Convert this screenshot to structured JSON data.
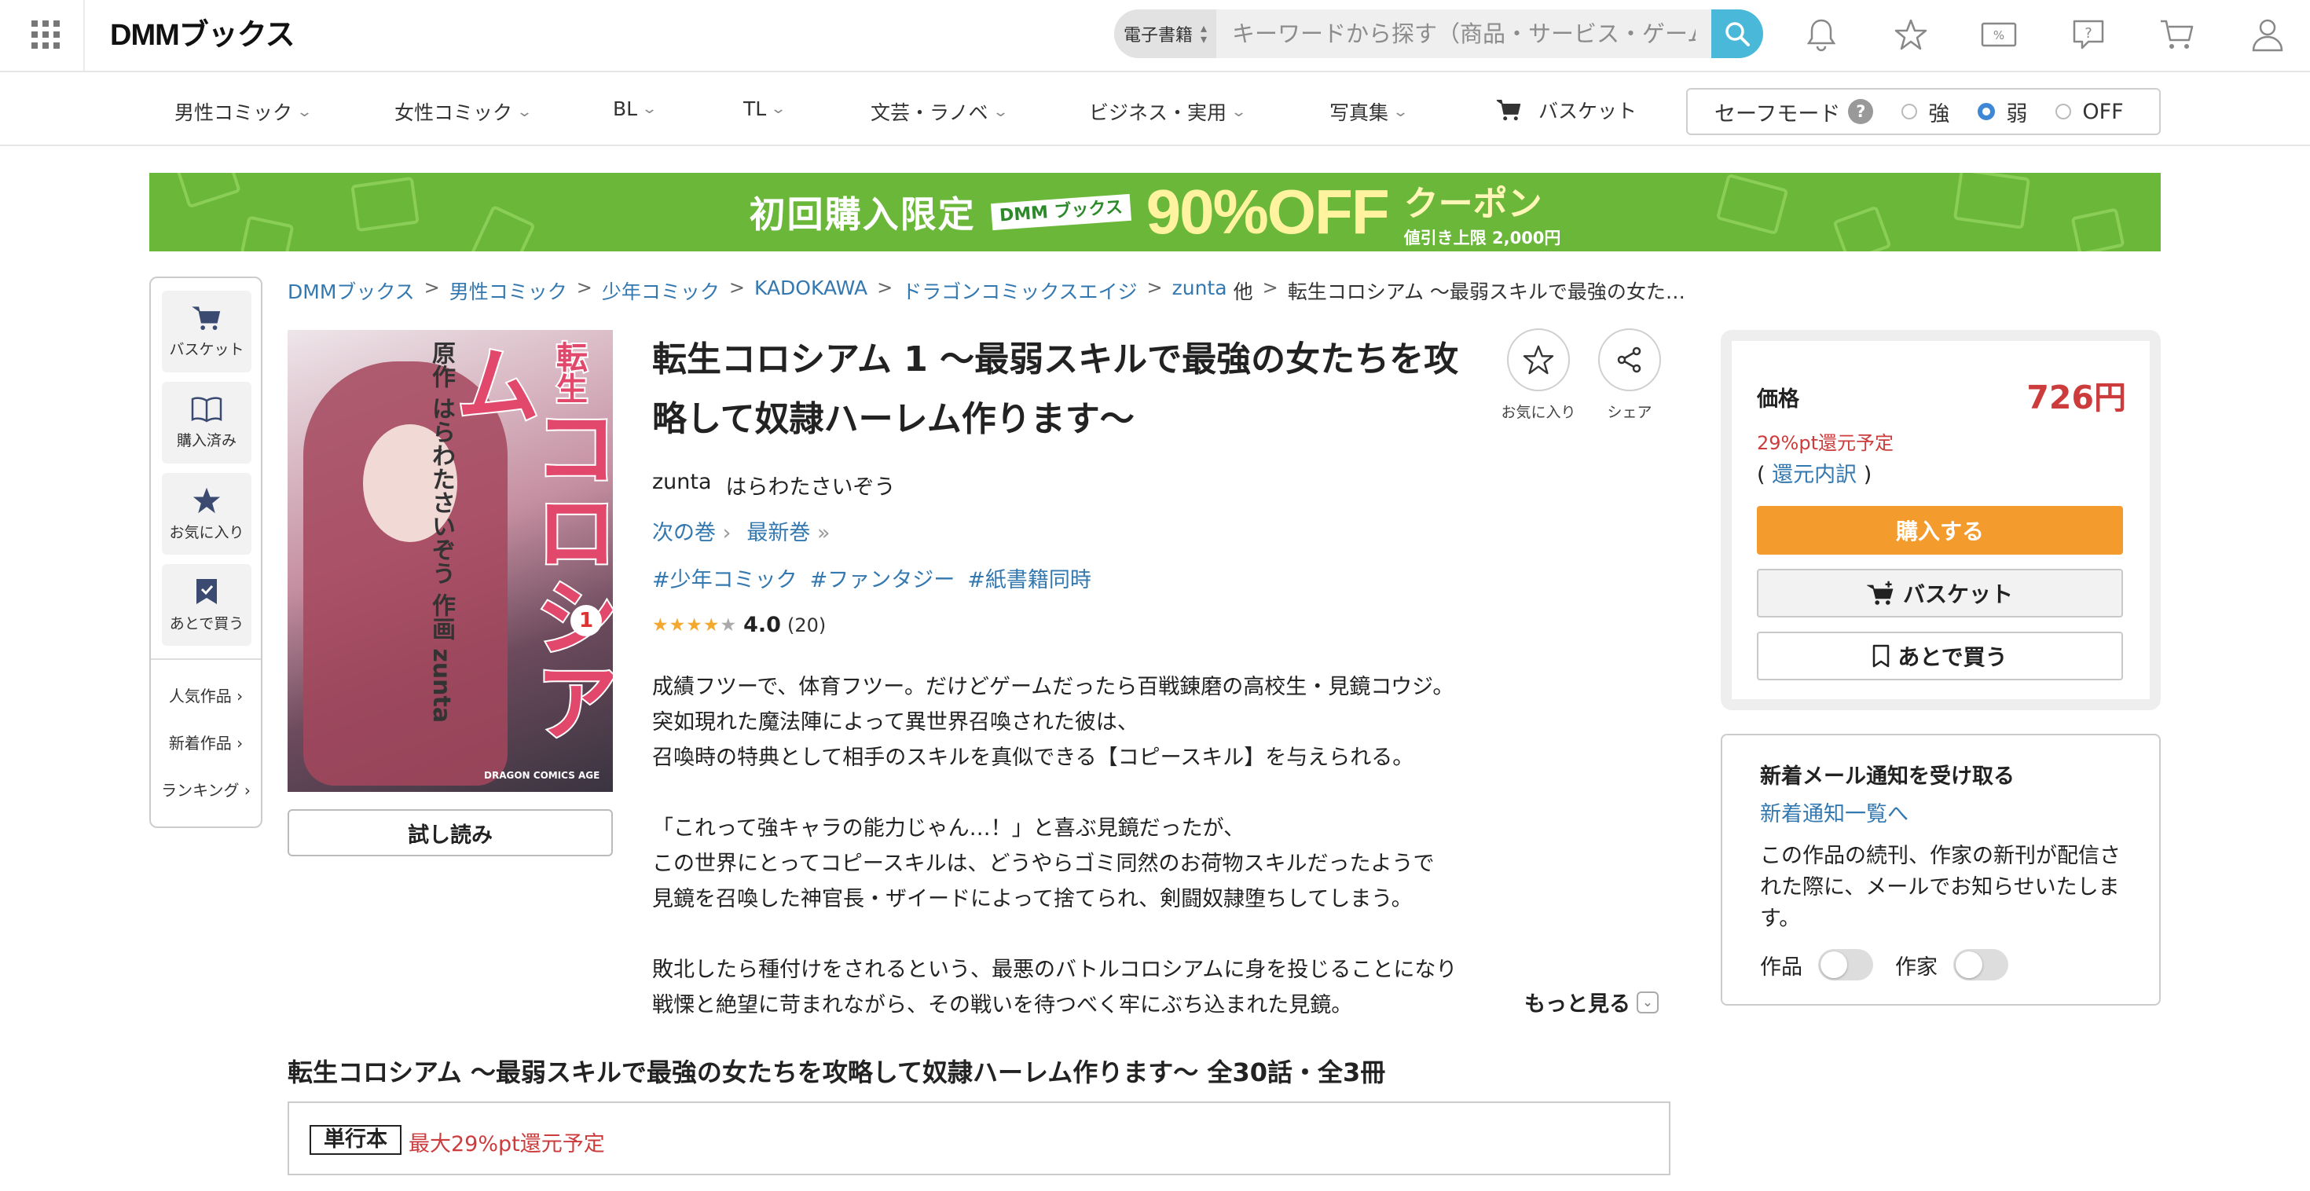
{
  "header": {
    "logo": "DMMブックス",
    "search_category": "電子書籍",
    "search_placeholder": "キーワードから探す（商品・サービス・ゲーム",
    "accent": "#4ab8d8"
  },
  "nav": {
    "items": [
      "男性コミック",
      "女性コミック",
      "BL",
      "TL",
      "文芸・ラノベ",
      "ビジネス・実用",
      "写真集"
    ],
    "basket": "バスケット",
    "safe_mode": {
      "label": "セーフモード",
      "help": "?",
      "options": [
        "強",
        "弱",
        "OFF"
      ],
      "selected": "弱"
    }
  },
  "banner": {
    "lead": "初回購入限定",
    "badge": "DMM ブックス",
    "discount": "90%OFF",
    "coupon": "クーポン",
    "cap": "値引き上限 2,000円",
    "color": "#6bb73a"
  },
  "sidebar": {
    "buttons": [
      {
        "label": "バスケット",
        "icon": "cart-icon"
      },
      {
        "label": "購入済み",
        "icon": "book-icon"
      },
      {
        "label": "お気に入り",
        "icon": "star-icon"
      },
      {
        "label": "あとで買う",
        "icon": "bookmark-icon"
      }
    ],
    "links": [
      "人気作品",
      "新着作品",
      "ランキング"
    ]
  },
  "breadcrumb": {
    "items": [
      "DMMブックス",
      "男性コミック",
      "少年コミック",
      "KADOKAWA",
      "ドラゴンコミックスエイジ",
      "zunta"
    ],
    "other": "他",
    "current": "転生コロシアム ～最弱スキルで最強の女た…"
  },
  "cover": {
    "title": "コロシアム",
    "prefix": "転生",
    "credits": "原作 はらわたさいぞう 作画 zunta",
    "volume": "1",
    "publisher": "DRAGON COMICS AGE"
  },
  "product": {
    "title": "転生コロシアム 1 ～最弱スキルで最強の女たちを攻略して奴隷ハーレム作ります～",
    "authors": [
      "zunta",
      "はらわたさいぞう"
    ],
    "next_volume": "次の巻",
    "latest_volume": "最新巻",
    "tags": [
      "#少年コミック",
      "#ファンタジー",
      "#紙書籍同時"
    ],
    "rating": 4.0,
    "rating_label": "4.0",
    "review_count": "(20)",
    "favorite_label": "お気に入り",
    "share_label": "シェア",
    "trial_label": "試し読み",
    "description": [
      "成績フツーで、体育フツー。だけどゲームだったら百戦錬磨の高校生・見鏡コウジ。",
      "突如現れた魔法陣によって異世界召喚された彼は、",
      "召喚時の特典として相手のスキルを真似できる【コピースキル】を与えられる。",
      "",
      "「これって強キャラの能力じゃん…！」と喜ぶ見鏡だったが、",
      "この世界にとってコピースキルは、どうやらゴミ同然のお荷物スキルだったようで",
      "見鏡を召喚した神官長・ザイードによって捨てられ、剣闘奴隷堕ちしてしまう。",
      "",
      "敗北したら種付けをされるという、最悪のバトルコロシアムに身を投じることになり",
      "戦慄と絶望に苛まれながら、その戦いを待つべく牢にぶち込まれた見鏡。"
    ],
    "more_label": "もっと見る"
  },
  "series": {
    "title": "転生コロシアム ～最弱スキルで最強の女たちを攻略して奴隷ハーレム作ります～ 全30話・全3冊",
    "format_tag": "単行本",
    "format_points": "最大29%pt還元予定"
  },
  "price_box": {
    "label": "価格",
    "price": "726円",
    "points": "29%pt還元予定",
    "breakdown_open": "(",
    "breakdown_link": "還元内訳",
    "breakdown_close": ")",
    "buy": "購入する",
    "basket": "バスケット",
    "later": "あとで買う",
    "buy_color": "#f39b2c",
    "price_color": "#cc3c3c"
  },
  "mail_box": {
    "title": "新着メール通知を受け取る",
    "link": "新着通知一覧へ",
    "description": "この作品の続刊、作家の新刊が配信された際に、メールでお知らせいたします。",
    "toggles": [
      "作品",
      "作家"
    ]
  }
}
